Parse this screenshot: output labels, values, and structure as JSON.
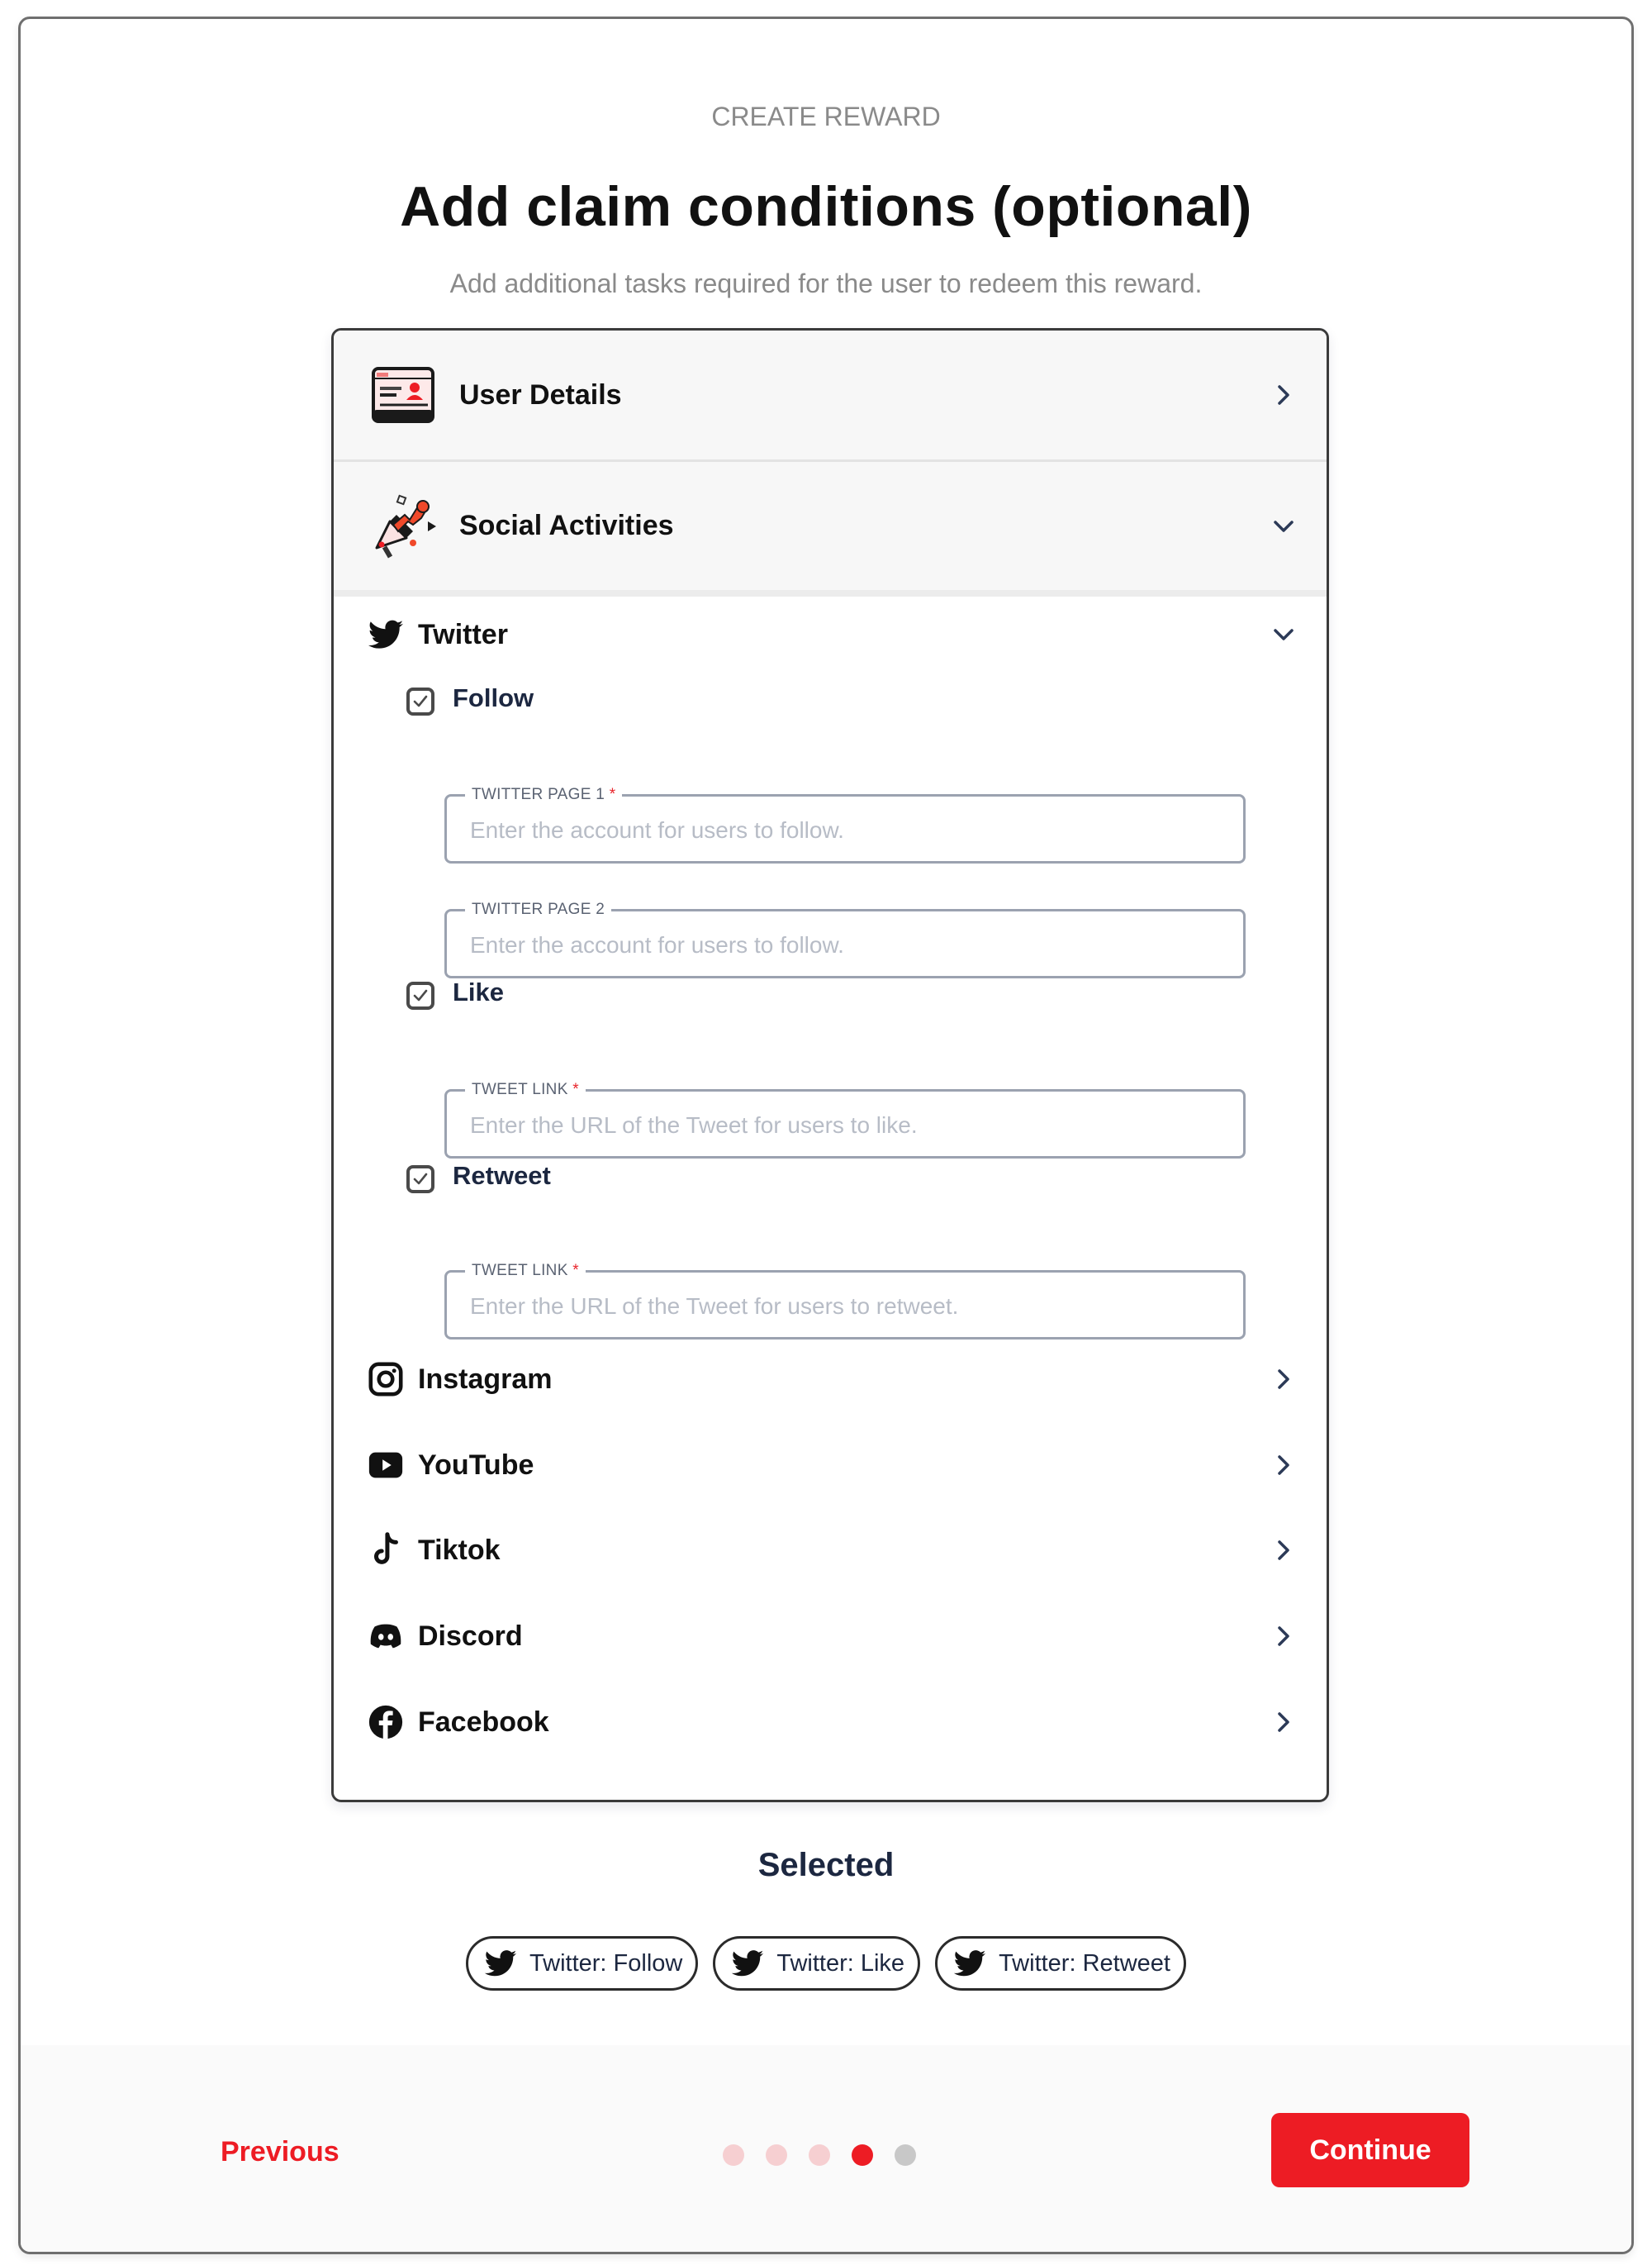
{
  "header": {
    "eyebrow": "CREATE REWARD",
    "title": "Add claim conditions (optional)",
    "subtitle": "Add additional tasks required for the user to redeem this reward."
  },
  "sections": {
    "user_details": {
      "label": "User Details",
      "icon": "id-card-icon",
      "expanded": false
    },
    "social_activities": {
      "label": "Social Activities",
      "icon": "megaphone-icon",
      "expanded": true
    }
  },
  "twitter": {
    "label": "Twitter",
    "expanded": true,
    "tasks": {
      "follow": {
        "label": "Follow",
        "checked": true,
        "fields": [
          {
            "legend": "TWITTER PAGE 1",
            "required": "*",
            "placeholder": "Enter the account for users to follow.",
            "value": ""
          },
          {
            "legend": "TWITTER PAGE 2",
            "required": "",
            "placeholder": "Enter the account for users to follow.",
            "value": ""
          }
        ]
      },
      "like": {
        "label": "Like",
        "checked": true,
        "fields": [
          {
            "legend": "TWEET LINK",
            "required": "*",
            "placeholder": "Enter the URL of the Tweet for users to like.",
            "value": ""
          }
        ]
      },
      "retweet": {
        "label": "Retweet",
        "checked": true,
        "fields": [
          {
            "legend": "TWEET LINK",
            "required": "*",
            "placeholder": "Enter the URL of the Tweet for users to retweet.",
            "value": ""
          }
        ]
      }
    }
  },
  "platforms": [
    {
      "label": "Instagram",
      "icon": "instagram-icon",
      "expanded": false
    },
    {
      "label": "YouTube",
      "icon": "youtube-icon",
      "expanded": false
    },
    {
      "label": "Tiktok",
      "icon": "tiktok-icon",
      "expanded": false
    },
    {
      "label": "Discord",
      "icon": "discord-icon",
      "expanded": false
    },
    {
      "label": "Facebook",
      "icon": "facebook-icon",
      "expanded": false
    }
  ],
  "selected": {
    "title": "Selected",
    "chips": [
      {
        "label": "Twitter: Follow",
        "icon": "twitter-icon"
      },
      {
        "label": "Twitter: Like",
        "icon": "twitter-icon"
      },
      {
        "label": "Twitter: Retweet",
        "icon": "twitter-icon"
      }
    ]
  },
  "footer": {
    "previous_label": "Previous",
    "continue_label": "Continue",
    "steps_total": 5,
    "current_step": 4
  },
  "colors": {
    "accent": "#ed1c24",
    "accent_light": "#f6cfd1",
    "step_inactive": "#c8c8c8",
    "heading_navy": "#1c2740"
  }
}
